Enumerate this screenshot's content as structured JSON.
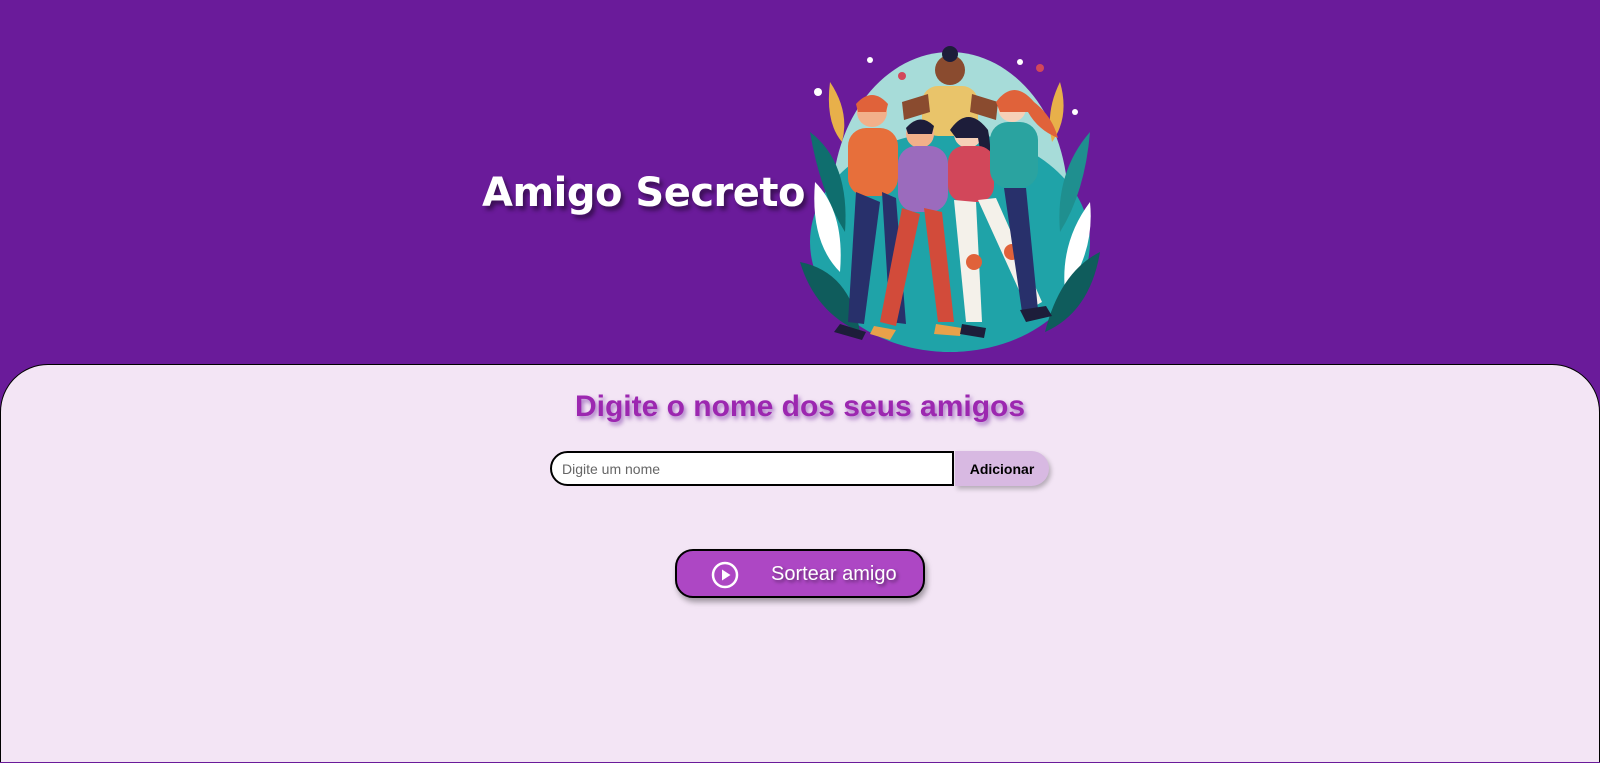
{
  "header": {
    "title": "Amigo Secreto",
    "hero_image": "friends-group-hug-illustration"
  },
  "main": {
    "subtitle": "Digite o nome dos seus amigos",
    "name_input": {
      "value": "",
      "placeholder": "Digite um nome"
    },
    "add_button_label": "Adicionar",
    "draw_button": {
      "label": "Sortear amigo",
      "icon": "play-circle-icon"
    }
  },
  "colors": {
    "header_bg": "#6a1b9a",
    "main_bg": "#f3e5f5",
    "subtitle": "#9c27b0",
    "add_button_bg": "#d8b9e2",
    "draw_button_bg": "#ad47c4"
  }
}
